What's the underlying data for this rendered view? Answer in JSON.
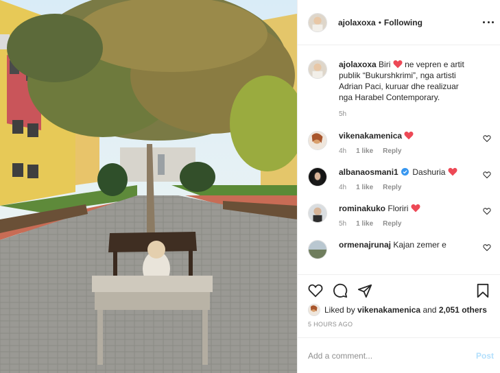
{
  "post": {
    "username": "ajolaxoxa",
    "follow_separator": "•",
    "follow_status": "Following",
    "more_icon": "more-horizontal-icon"
  },
  "caption": {
    "username": "ajolaxoxa",
    "word_before_heart": "Biri",
    "text_after_heart": "ne vepren e artit publik “Bukurshkrimi”, nga artisti Adrian Paci, kuruar dhe realizuar nga Harabel Contemporary.",
    "time": "5h"
  },
  "comments": [
    {
      "username": "vikenakamenica",
      "text": "",
      "has_heart": true,
      "verified": false,
      "time": "4h",
      "likes": "1 like",
      "reply": "Reply"
    },
    {
      "username": "albanaosmani1",
      "text": "Dashuria",
      "has_heart": true,
      "verified": true,
      "time": "4h",
      "likes": "1 like",
      "reply": "Reply"
    },
    {
      "username": "rominakuko",
      "text": "Floriri",
      "has_heart": true,
      "verified": false,
      "time": "5h",
      "likes": "1 like",
      "reply": "Reply"
    },
    {
      "username": "ormenajrunaj",
      "text": "Kajan zemer e",
      "has_heart": false,
      "verified": false,
      "time": "",
      "likes": "",
      "reply": ""
    }
  ],
  "actions": {
    "like_icon": "heart-icon",
    "comment_icon": "comment-icon",
    "share_icon": "share-icon",
    "save_icon": "bookmark-icon"
  },
  "likes": {
    "prefix": "Liked by",
    "user": "vikenakamenica",
    "conjunction": "and",
    "others": "2,051 others"
  },
  "timestamp": "5 HOURS AGO",
  "comment_input": {
    "placeholder": "Add a comment...",
    "post_label": "Post"
  },
  "colors": {
    "heart_red": "#ed4956",
    "verified_blue": "#3897f0",
    "post_button_disabled": "#b2dffc",
    "muted_text": "#8e8e8e"
  }
}
